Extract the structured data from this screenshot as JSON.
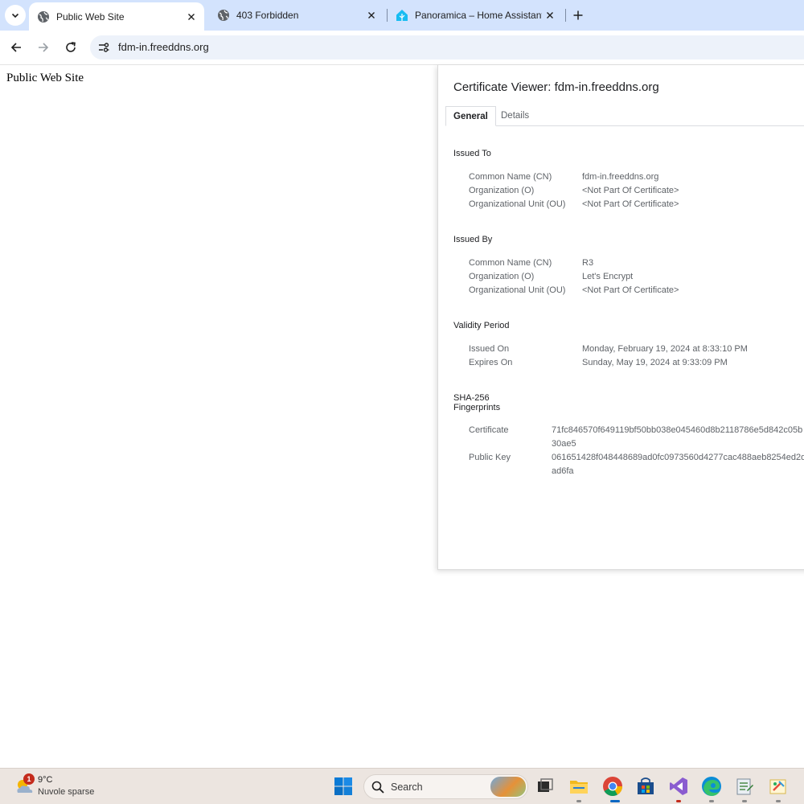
{
  "browser": {
    "tabs": [
      {
        "title": "Public Web Site",
        "active": true,
        "favicon": "globe-icon"
      },
      {
        "title": "403 Forbidden",
        "active": false,
        "favicon": "globe-icon"
      },
      {
        "title": "Panoramica – Home Assistant",
        "active": false,
        "favicon": "home-assistant-icon"
      }
    ],
    "address_url": "fdm-in.freeddns.org"
  },
  "page": {
    "heading": "Public Web Site"
  },
  "certificate_viewer": {
    "title": "Certificate Viewer: fdm-in.freeddns.org",
    "tabs": [
      "General",
      "Details"
    ],
    "issued_to": {
      "title": "Issued To",
      "rows": [
        {
          "label": "Common Name (CN)",
          "value": "fdm-in.freeddns.org"
        },
        {
          "label": "Organization (O)",
          "value": "<Not Part Of Certificate>"
        },
        {
          "label": "Organizational Unit (OU)",
          "value": "<Not Part Of Certificate>"
        }
      ]
    },
    "issued_by": {
      "title": "Issued By",
      "rows": [
        {
          "label": "Common Name (CN)",
          "value": "R3"
        },
        {
          "label": "Organization (O)",
          "value": "Let's Encrypt"
        },
        {
          "label": "Organizational Unit (OU)",
          "value": "<Not Part Of Certificate>"
        }
      ]
    },
    "validity": {
      "title": "Validity Period",
      "rows": [
        {
          "label": "Issued On",
          "value": "Monday, February 19, 2024 at 8:33:10 PM"
        },
        {
          "label": "Expires On",
          "value": "Sunday, May 19, 2024 at 9:33:09 PM"
        }
      ]
    },
    "fingerprints": {
      "title_line1": "SHA-256",
      "title_line2": "Fingerprints",
      "rows": [
        {
          "label": "Certificate",
          "value_line1": "71fc846570f649119bf50bb038e045460d8b2118786e5d842c05b",
          "value_line2": "30ae5"
        },
        {
          "label": "Public Key",
          "value_line1": "061651428f048448689ad0fc0973560d4277cac488aeb8254ed2d",
          "value_line2": "ad6fa"
        }
      ]
    }
  },
  "taskbar": {
    "weather": {
      "temp": "9°C",
      "desc": "Nuvole sparse",
      "badge": "1"
    },
    "search_label": "Search",
    "apps": [
      "task-view-icon",
      "file-explorer-icon",
      "chrome-icon",
      "microsoft-store-icon",
      "visual-studio-icon",
      "edge-icon",
      "notepad-icon",
      "paint-icon"
    ]
  },
  "colors": {
    "tabstrip_bg": "#d3e3fd",
    "omnibox_bg": "#edf2fa",
    "taskbar_bg": "#ece5e0"
  }
}
